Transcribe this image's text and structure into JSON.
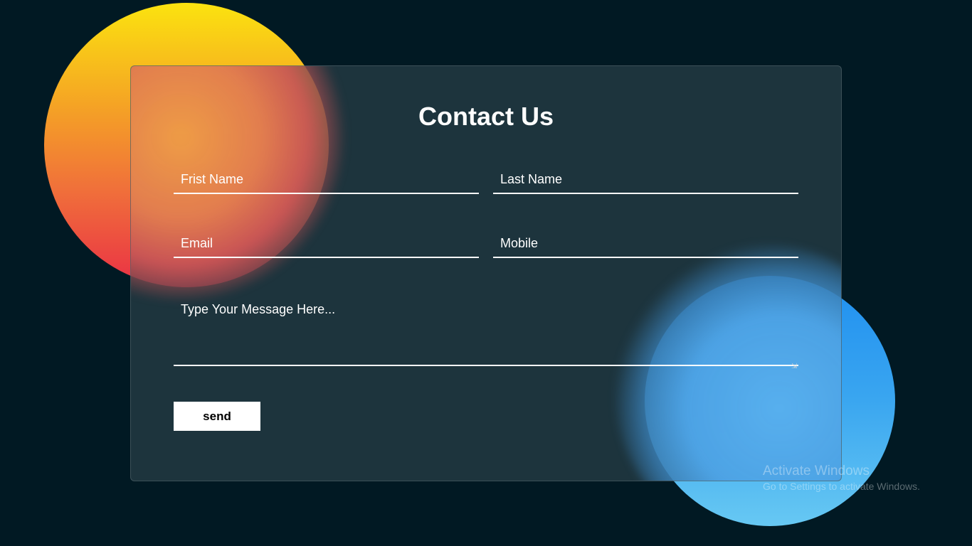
{
  "page": {
    "title": "Contact Us"
  },
  "form": {
    "first_name_placeholder": "Frist Name",
    "last_name_placeholder": "Last Name",
    "email_placeholder": "Email",
    "mobile_placeholder": "Mobile",
    "message_placeholder": "Type Your Message Here...",
    "send_label": "send"
  },
  "watermark": {
    "title": "Activate Windows",
    "subtitle": "Go to Settings to activate Windows."
  },
  "colors": {
    "background": "#011923",
    "card": "#24373f",
    "orange_top": "#fbe30f",
    "orange_bottom": "#ea3045",
    "blue_top": "#1f8ff0",
    "blue_bottom": "#67c8f3",
    "button_bg": "#ffffff"
  }
}
